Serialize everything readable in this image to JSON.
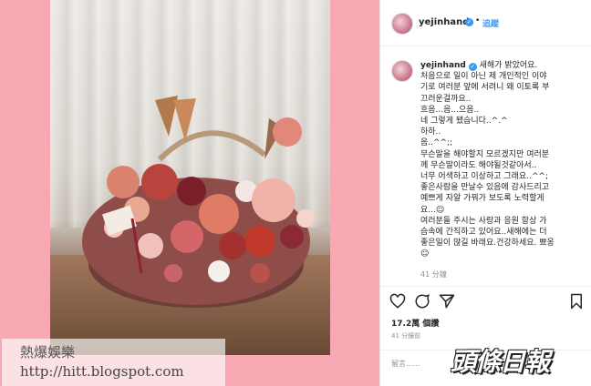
{
  "post": {
    "username": "yejinhand",
    "follow_label": "追蹤",
    "caption_username": "yejinhand",
    "caption_lines": [
      "새해가 밝았어요.",
      "처음으로 일이 아닌 제 개인적인 이야",
      "기로 여러분 앞에 서려니 왜 이토록 부",
      "끄러운걸까요..",
      "흐음...음...으음..",
      "네 그렇게 됐습니다..^.^",
      "하하..",
      "음..^^;;",
      "무슨말을 해야할지 모르겠지만 여러분",
      "께 무슨말이라도 해야될것같아서..",
      "너무 어색하고 이상하고 그래요..^^;",
      "좋은사람을 만날수 있음에 감사드리고",
      "예쁘게 자알 가꿔가 보도록 노력할게",
      "요...☺",
      "여러분들 주시는 사랑과 응원 항상 가",
      "슴속에 간직하고 있어요..새해에는 더",
      "좋은일이 많길 바래요.건강하세요. 뾰옹",
      "☺"
    ],
    "caption_time": "41 分鐘",
    "likes": "17.2萬 個讚",
    "post_time": "41 分鐘前",
    "comment_placeholder": "留言......"
  },
  "watermarks": {
    "site_title": "熱爆娛樂",
    "site_url": "http://hitt.blogspot.com",
    "brand": "頭條日報"
  },
  "colors": {
    "background_pink": "#f7a8b2",
    "verified_blue": "#3897f0",
    "follow_blue": "#3897f0"
  },
  "icons": [
    "heart-icon",
    "comment-icon",
    "share-icon",
    "bookmark-icon",
    "verified-icon"
  ]
}
